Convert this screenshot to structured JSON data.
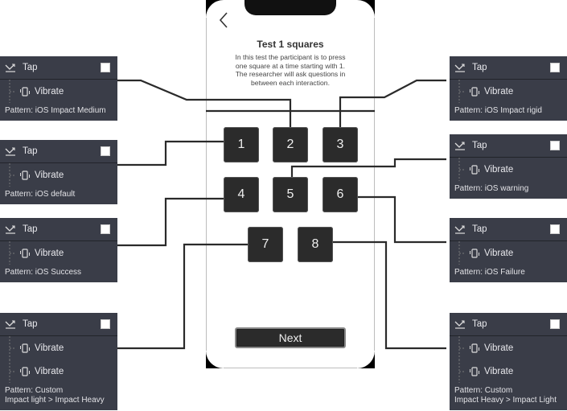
{
  "phone": {
    "back_icon": "chevron-left-icon",
    "title": "Test 1 squares",
    "description": "In this test the participant is to press one square at a time starting with 1. The researcher will ask questions in between each interaction.",
    "squares": [
      "1",
      "2",
      "3",
      "4",
      "5",
      "6",
      "7",
      "8"
    ],
    "next_label": "Next"
  },
  "panels": [
    {
      "square": "2",
      "side": "left",
      "trigger": "Tap",
      "actions": [
        "Vibrate"
      ],
      "pattern": [
        "Pattern: iOS Impact Medium"
      ]
    },
    {
      "square": "1",
      "side": "left",
      "trigger": "Tap",
      "actions": [
        "Vibrate"
      ],
      "pattern": [
        "Pattern: iOS default"
      ]
    },
    {
      "square": "4",
      "side": "left",
      "trigger": "Tap",
      "actions": [
        "Vibrate"
      ],
      "pattern": [
        "Pattern: iOS Success"
      ]
    },
    {
      "square": "7",
      "side": "left",
      "trigger": "Tap",
      "actions": [
        "Vibrate",
        "Vibrate"
      ],
      "pattern": [
        "Pattern: Custom",
        "Impact light > Impact Heavy"
      ]
    },
    {
      "square": "3",
      "side": "right",
      "trigger": "Tap",
      "actions": [
        "Vibrate"
      ],
      "pattern": [
        "Pattern: iOS Impact rigid"
      ]
    },
    {
      "square": "5",
      "side": "right",
      "trigger": "Tap",
      "actions": [
        "Vibrate"
      ],
      "pattern": [
        "Pattern: iOS warning"
      ]
    },
    {
      "square": "6",
      "side": "right",
      "trigger": "Tap",
      "actions": [
        "Vibrate"
      ],
      "pattern": [
        "Pattern: iOS Failure"
      ]
    },
    {
      "square": "8",
      "side": "right",
      "trigger": "Tap",
      "actions": [
        "Vibrate",
        "Vibrate"
      ],
      "pattern": [
        "Pattern: Custom",
        "Impact Heavy > Impact Light"
      ]
    }
  ],
  "icons": {
    "trigger": "tap-gesture-icon",
    "action": "vibrate-phone-icon",
    "checkbox": "checkbox"
  }
}
